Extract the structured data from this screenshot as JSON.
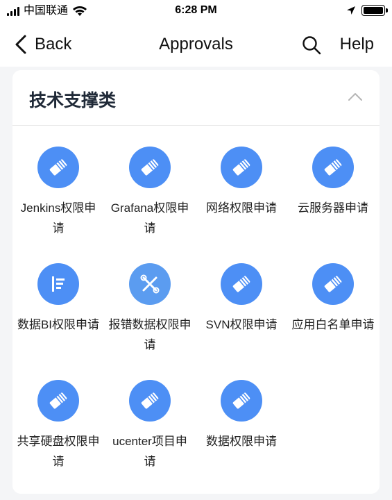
{
  "status_bar": {
    "carrier": "中国联通",
    "time": "6:28 PM",
    "icons": [
      "signal-icon",
      "wifi-icon",
      "location-arrow-icon",
      "battery-icon"
    ]
  },
  "nav": {
    "back_label": "Back",
    "title": "Approvals",
    "help_label": "Help",
    "icons": [
      "chevron-left-icon",
      "search-icon"
    ]
  },
  "section": {
    "title": "技术支撑类",
    "collapse_icon": "chevron-up-icon",
    "items": [
      {
        "label": "Jenkins权限申请",
        "icon": "ticket-icon",
        "color": "#4d8ff5"
      },
      {
        "label": "Grafana权限申请",
        "icon": "ticket-icon",
        "color": "#4d8ff5"
      },
      {
        "label": "网络权限申请",
        "icon": "ticket-icon",
        "color": "#4d8ff5"
      },
      {
        "label": "云服务器申请",
        "icon": "ticket-icon",
        "color": "#4d8ff5"
      },
      {
        "label": "数据BI权限申请",
        "icon": "list-doc-icon",
        "color": "#4d8ff5"
      },
      {
        "label": "报错数据权限申请",
        "icon": "tools-icon",
        "color": "#5b9cf0"
      },
      {
        "label": "SVN权限申请",
        "icon": "ticket-icon",
        "color": "#4d8ff5"
      },
      {
        "label": "应用白名单申请",
        "icon": "ticket-icon",
        "color": "#4d8ff5"
      },
      {
        "label": "共享硬盘权限申请",
        "icon": "ticket-icon",
        "color": "#4d8ff5"
      },
      {
        "label": "ucenter项目申请",
        "icon": "ticket-icon",
        "color": "#4d8ff5"
      },
      {
        "label": "数据权限申请",
        "icon": "ticket-icon",
        "color": "#4d8ff5"
      }
    ]
  },
  "colors": {
    "accent": "#4d8ff5",
    "background": "#f4f5f7"
  }
}
